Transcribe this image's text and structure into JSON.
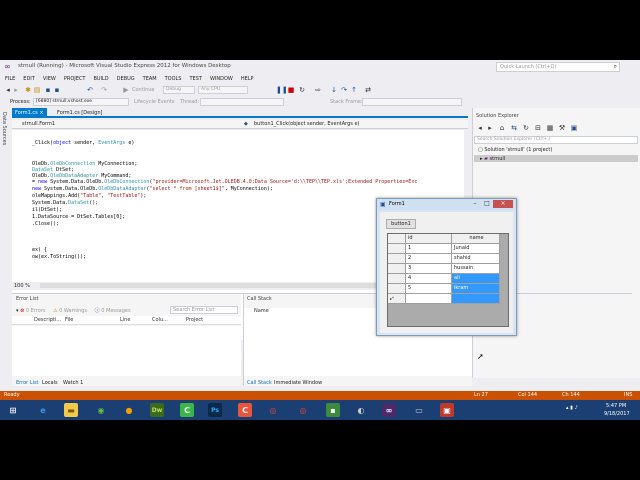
{
  "window": {
    "title": "strnull (Running) - Microsoft Visual Studio Express 2012 for Windows Desktop",
    "quick_launch_placeholder": "Quick Launch (Ctrl+Q)"
  },
  "menu": [
    "FILE",
    "EDIT",
    "VIEW",
    "PROJECT",
    "BUILD",
    "DEBUG",
    "TEAM",
    "TOOLS",
    "TEST",
    "WINDOW",
    "HELP"
  ],
  "toolbar": {
    "continue_label": "Continue",
    "config_value": "Debug",
    "platform_value": "Any CPU",
    "process_label": "Process:",
    "process_value": "[6880] strnull.vshost.exe",
    "lifecycle_label": "Lifecycle Events",
    "thread_label": "Thread:",
    "stack_frame_label": "Stack Frame:"
  },
  "data_sources_label": "Data Sources",
  "editor": {
    "tabs": [
      "Form1.cs",
      "Form1.cs [Design]"
    ],
    "nav_left": "strnull.Form1",
    "nav_right": "button1_Click(object sender, EventArgs e)",
    "zoom": "100 %",
    "lines": [
      "_Click(object sender, EventArgs e)",
      "",
      "",
      "OleDb.OleDbConnection MyConnection;",
      "DataSet DtSet;",
      "OleDb.OleDbDataAdapter MyCommand;",
      " = new System.Data.OleDb.OleDbConnection(\"provider=Microsoft.Jet.OLEDB.4.0;Data Source='d:\\\\TEP\\\\TEP.xls';Extended Properties=Exc",
      "new System.Data.OleDb.OleDbDataAdapter(\"select * from [sheet1$]\", MyConnection);",
      "oleMappings.Add(\"Table\", \"TestTable\");",
      "System.Data.DataSet();",
      "il(DtSet);",
      "1.DataSource = DtSet.Tables[0];",
      ".Close();",
      "",
      "",
      "ex) {",
      "ow(ex.ToString());"
    ]
  },
  "solution_explorer": {
    "title": "Solution Explorer",
    "search_placeholder": "Search Solution Explorer (Ctrl+;)",
    "solution_label": "Solution 'strnull' (1 project)",
    "project_label": "strnull"
  },
  "error_list": {
    "title": "Error List",
    "errors": "0 Errors",
    "warnings": "0 Warnings",
    "messages": "0 Messages",
    "search_placeholder": "Search Error List",
    "columns": [
      "Descripti...",
      "File",
      "Line",
      "Colu...",
      "Project"
    ]
  },
  "call_stack": {
    "title": "Call Stack",
    "column": "Name"
  },
  "bottom_tabs_left": [
    "Error List",
    "Locals",
    "Watch 1"
  ],
  "bottom_tabs_right": [
    "Call Stack",
    "Immediate Window"
  ],
  "status": {
    "text": "Ready",
    "ln": "Ln 27",
    "col": "Col 144",
    "ch": "Ch 144",
    "ins": "INS"
  },
  "form1": {
    "title": "Form1",
    "button_label": "button1",
    "columns": [
      "id",
      "name"
    ],
    "rows": [
      {
        "id": "1",
        "name": "Junaid"
      },
      {
        "id": "2",
        "name": "shahid"
      },
      {
        "id": "3",
        "name": "hussain"
      },
      {
        "id": "4",
        "name": "ali"
      },
      {
        "id": "5",
        "name": "ikram"
      }
    ],
    "new_row_marker": "▸*"
  },
  "taskbar": {
    "time": "5:47 PM",
    "date": "9/18/2017"
  }
}
